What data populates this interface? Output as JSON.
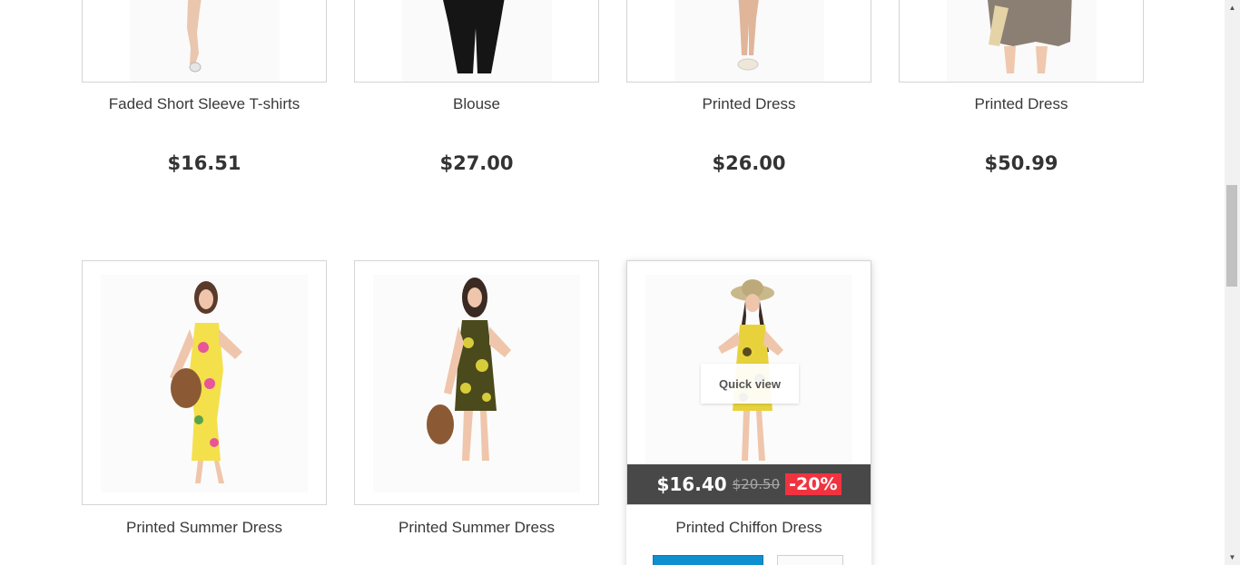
{
  "row1": [
    {
      "name": "Faded Short Sleeve T-shirts",
      "price": "$16.51"
    },
    {
      "name": "Blouse",
      "price": "$27.00"
    },
    {
      "name": "Printed Dress",
      "price": "$26.00"
    },
    {
      "name": "Printed Dress",
      "price": "$50.99"
    }
  ],
  "row2": [
    {
      "name": "Printed Summer Dress"
    },
    {
      "name": "Printed Summer Dress"
    },
    {
      "name": "Printed Chiffon Dress",
      "new_price": "$16.40",
      "old_price": "$20.50",
      "discount": "-20%",
      "quick_view": "Quick view"
    }
  ],
  "colors": {
    "accent": "#0e8fd0",
    "discount": "#f13340",
    "price_bar": "#484848"
  }
}
